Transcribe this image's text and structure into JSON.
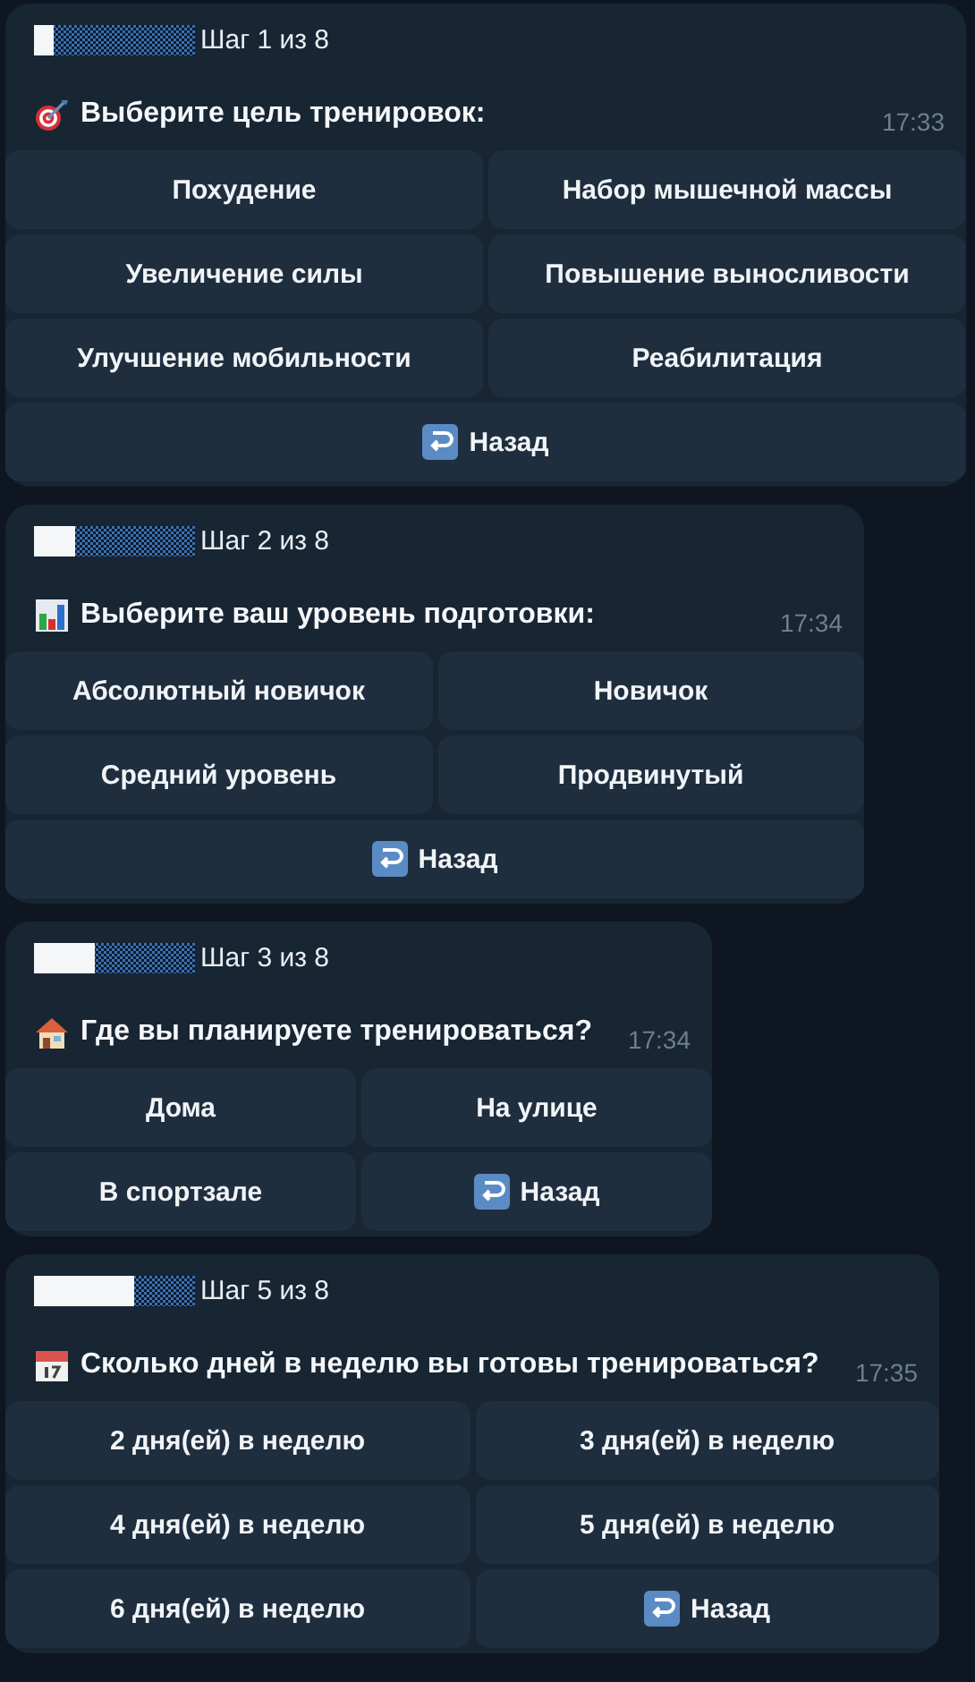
{
  "messages": [
    {
      "step": "Шаг 1 из 8",
      "level": 0.125,
      "text": "Выберите цель тренировок:",
      "time": "17:33",
      "rows": [
        [
          {
            "label": "Похудение",
            "kind": "option"
          },
          {
            "label": "Набор мышечной массы",
            "kind": "option"
          }
        ],
        [
          {
            "label": "Увеличение силы",
            "kind": "option"
          },
          {
            "label": "Повышение выносливости",
            "kind": "option"
          }
        ],
        [
          {
            "label": "Улучшение мобильности",
            "kind": "option"
          },
          {
            "label": "Реабилитация",
            "kind": "option"
          }
        ],
        [
          {
            "label": "Назад",
            "kind": "back"
          }
        ]
      ]
    },
    {
      "step": "Шаг 2 из 8",
      "level": 0.25,
      "text": "Выберите ваш уровень подготовки:",
      "time": "17:34",
      "rows": [
        [
          {
            "label": "Абсолютный новичок",
            "kind": "option"
          },
          {
            "label": "Новичок",
            "kind": "option"
          }
        ],
        [
          {
            "label": "Средний уровень",
            "kind": "option"
          },
          {
            "label": "Продвинутый",
            "kind": "option"
          }
        ],
        [
          {
            "label": "Назад",
            "kind": "back"
          }
        ]
      ]
    },
    {
      "step": "Шаг 3 из 8",
      "level": 0.375,
      "text": "Где вы планируете тренироваться?",
      "time": "17:34",
      "rows": [
        [
          {
            "label": "Дома",
            "kind": "option"
          },
          {
            "label": "На улице",
            "kind": "option"
          }
        ],
        [
          {
            "label": "В спортзале",
            "kind": "option"
          },
          {
            "label": "Назад",
            "kind": "back"
          }
        ]
      ]
    },
    {
      "step": "Шаг 5 из 8",
      "level": 0.625,
      "text": "Сколько дней в неделю вы готовы тренироваться?",
      "time": "17:35",
      "rows": [
        [
          {
            "label": "2 дня(ей) в неделю",
            "kind": "option"
          },
          {
            "label": "3 дня(ей) в неделю",
            "kind": "option"
          }
        ],
        [
          {
            "label": "4 дня(ей) в неделю",
            "kind": "option"
          },
          {
            "label": "5 дня(ей) в неделю",
            "kind": "option"
          }
        ],
        [
          {
            "label": "6 дня(ей) в неделю",
            "kind": "option"
          },
          {
            "label": "Назад",
            "kind": "back"
          }
        ]
      ]
    }
  ]
}
